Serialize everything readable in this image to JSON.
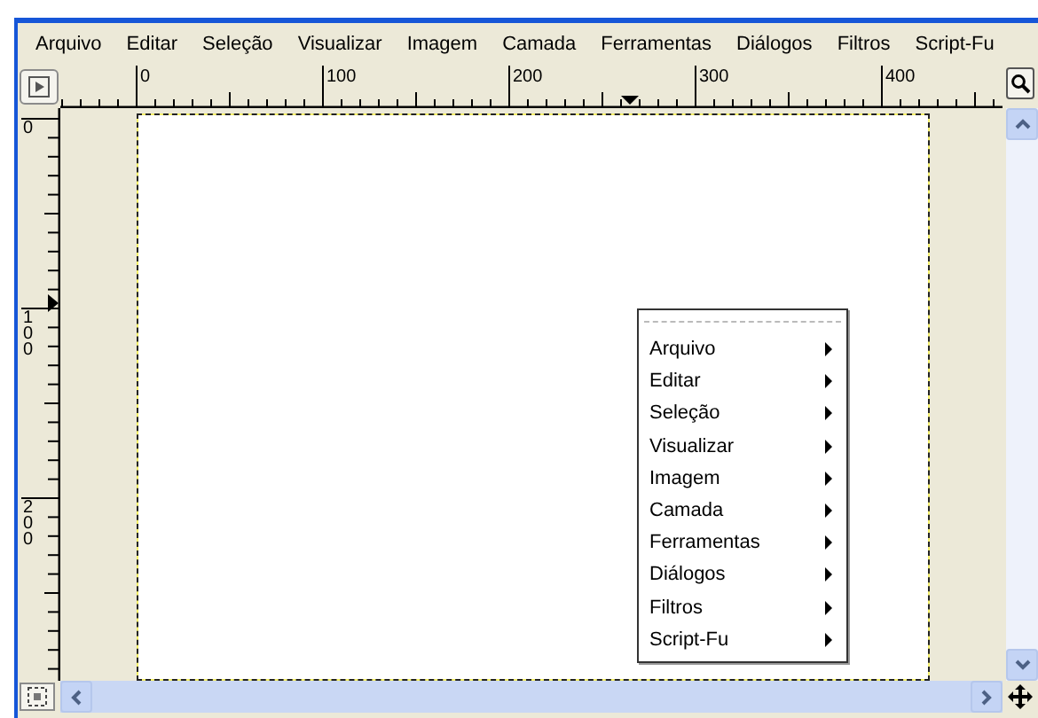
{
  "menubar": [
    {
      "label": "Arquivo"
    },
    {
      "label": "Editar"
    },
    {
      "label": "Seleção"
    },
    {
      "label": "Visualizar"
    },
    {
      "label": "Imagem"
    },
    {
      "label": "Camada"
    },
    {
      "label": "Ferramentas"
    },
    {
      "label": "Diálogos"
    },
    {
      "label": "Filtros"
    },
    {
      "label": "Script-Fu"
    }
  ],
  "ruler_horizontal": {
    "labels": [
      "0",
      "100",
      "200",
      "300",
      "400"
    ]
  },
  "ruler_vertical": {
    "labels": [
      "0",
      "100",
      "200"
    ]
  },
  "context_menu": {
    "items": [
      {
        "label": "Arquivo"
      },
      {
        "label": "Editar"
      },
      {
        "label": "Seleção"
      },
      {
        "label": "Visualizar"
      },
      {
        "label": "Imagem"
      },
      {
        "label": "Camada"
      },
      {
        "label": "Ferramentas"
      },
      {
        "label": "Diálogos"
      },
      {
        "label": "Filtros"
      },
      {
        "label": "Script-Fu"
      }
    ]
  }
}
